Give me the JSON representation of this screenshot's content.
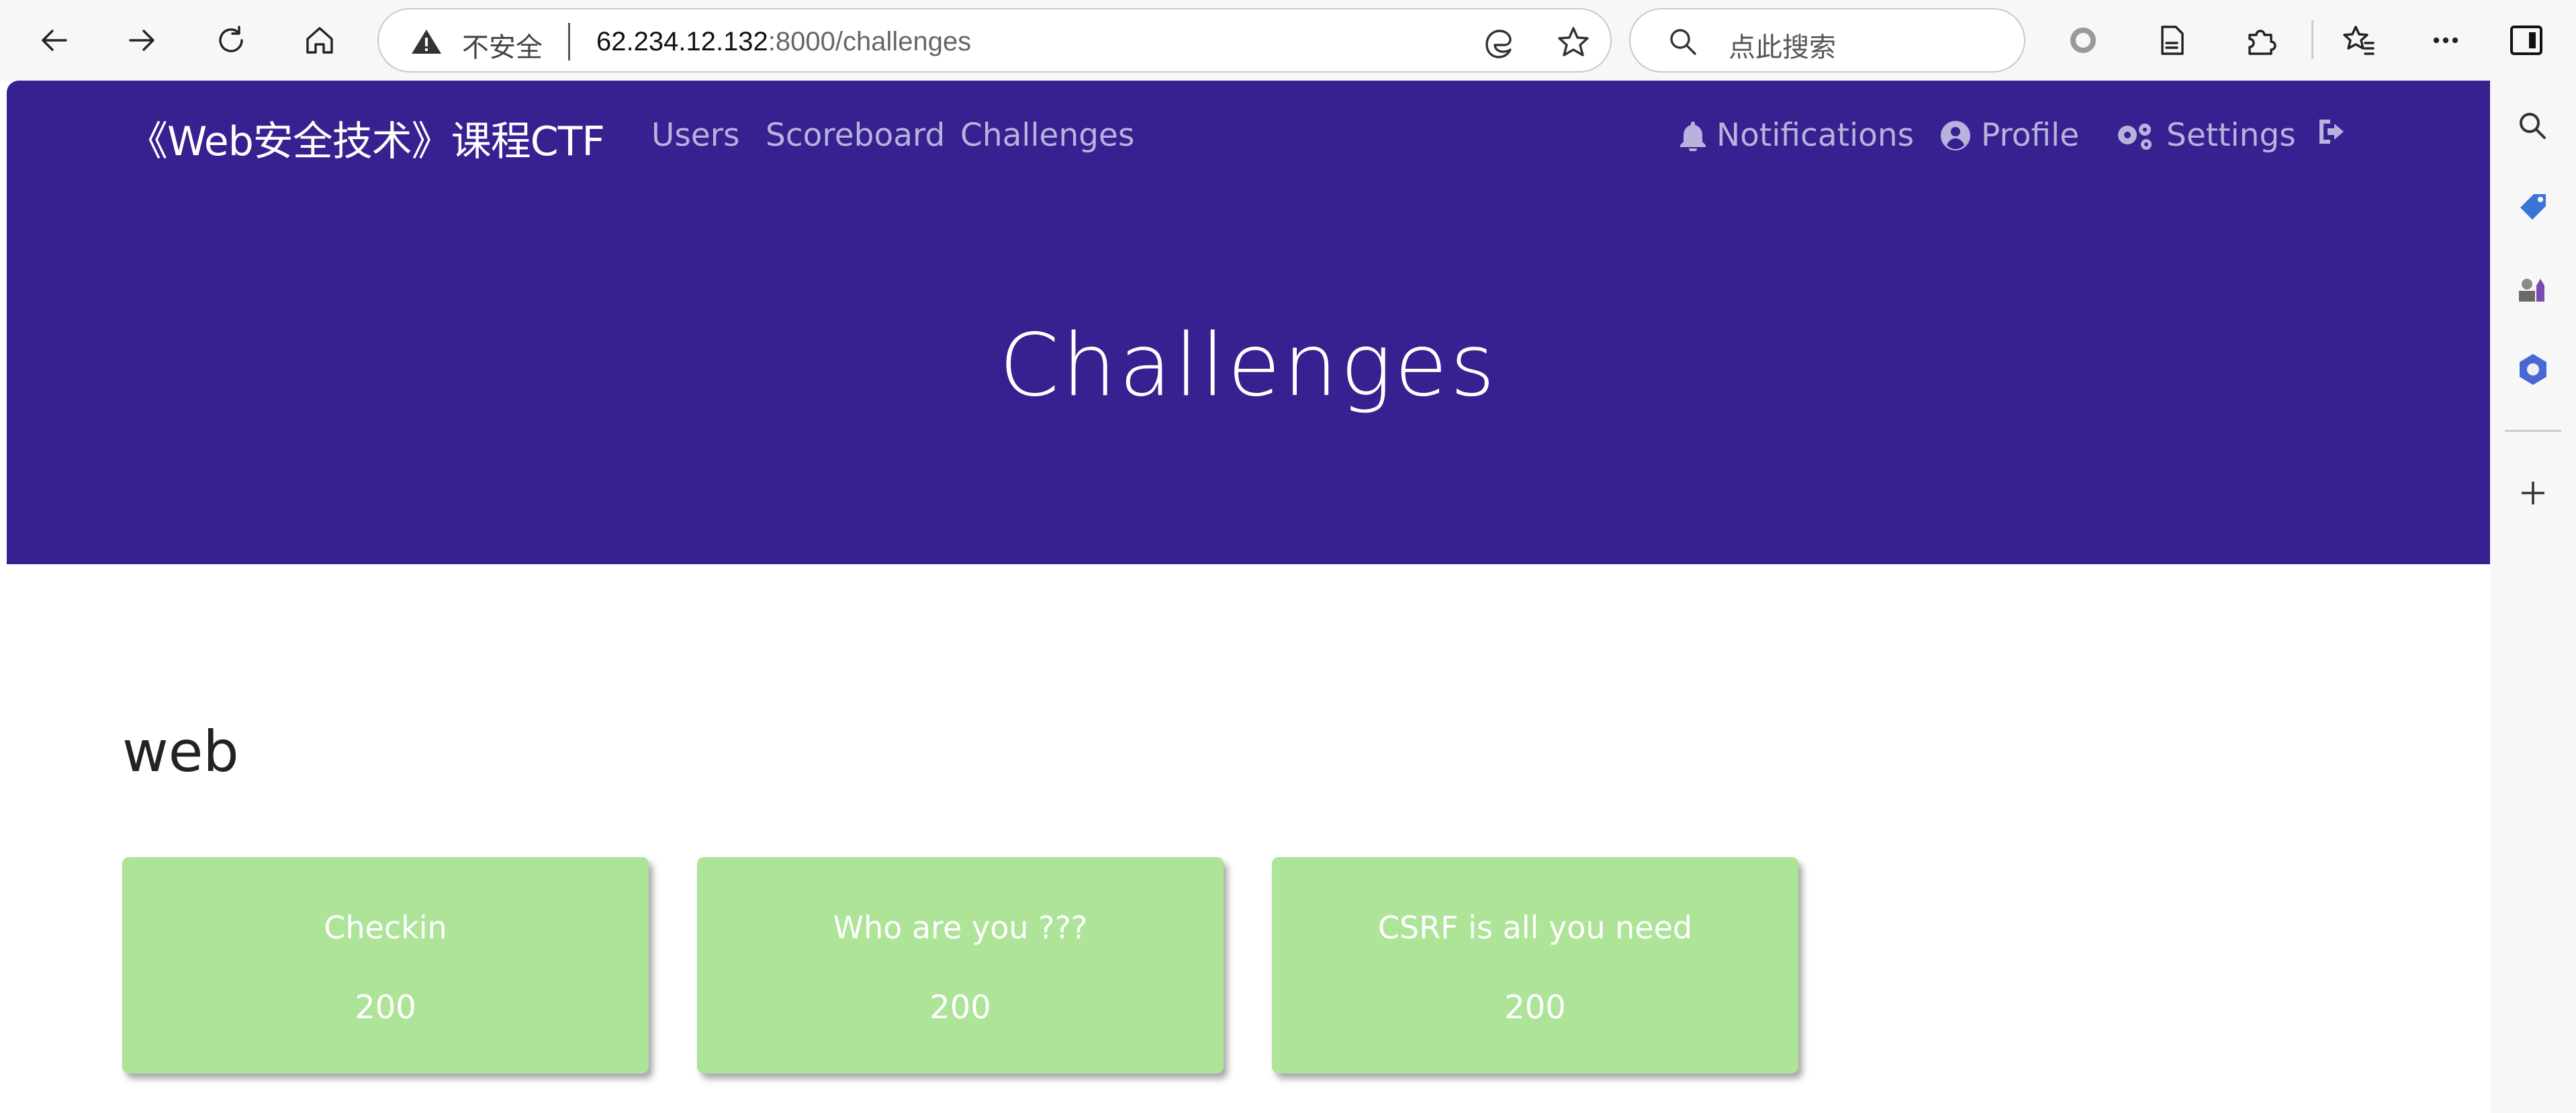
{
  "browser": {
    "security_label": "不安全",
    "url_host": "62.234.12.132",
    "url_rest": ":8000/challenges",
    "search_placeholder": "点此搜索",
    "icons": [
      "back-icon",
      "forward-icon",
      "refresh-icon",
      "home-icon",
      "warning-icon",
      "edge-icon",
      "favorite-star-icon",
      "search-icon",
      "circle-extension-icon",
      "reading-icon",
      "extensions-icon",
      "favorites-icon",
      "more-icon",
      "sidebar-toggle-icon"
    ]
  },
  "edge_sidebar": {
    "icons": [
      "search-icon",
      "tag-icon",
      "games-icon",
      "office-icon",
      "add-icon"
    ]
  },
  "nav": {
    "brand": "《Web安全技术》课程CTF",
    "links": [
      "Users",
      "Scoreboard",
      "Challenges"
    ],
    "notifications": "Notifications",
    "profile": "Profile",
    "settings": "Settings"
  },
  "page": {
    "title": "Challenges",
    "category": "web"
  },
  "challenges": [
    {
      "name": "Checkin",
      "points": "200"
    },
    {
      "name": "Who are you ???",
      "points": "200"
    },
    {
      "name": "CSRF is all you need",
      "points": "200"
    }
  ],
  "colors": {
    "navbar": "#37208f",
    "card": "#ade498",
    "nav_link": "#b8b2dd"
  }
}
